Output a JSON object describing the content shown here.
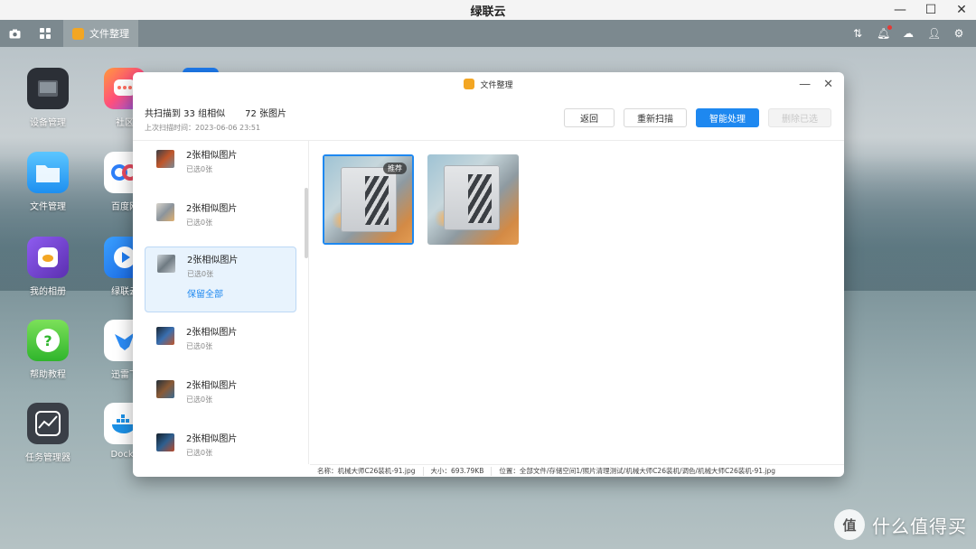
{
  "app_title": "绿联云",
  "window_controls": {
    "minimize": "—",
    "maximize": "☐",
    "close": "✕"
  },
  "taskbar": {
    "left_icons": [
      "camera-icon",
      "grid-apps-icon"
    ],
    "task_label": "文件整理",
    "right_icons": [
      "adjust-icon",
      "notification-bell-icon",
      "cloud-sync-icon",
      "user-icon",
      "settings-icon"
    ],
    "notification_dot_color": "#e53935"
  },
  "desktop": {
    "icons": [
      {
        "label": "设备管理",
        "icon": "device-manager-icon",
        "color": "#2b2f36"
      },
      {
        "label": "社区",
        "icon": "community-icon",
        "color": "#ff6f61"
      },
      {
        "label": "文件管理",
        "icon": "folder-icon",
        "color": "#1ea3f0"
      },
      {
        "label": "百度网",
        "icon": "baidu-netdisk-icon",
        "color": "#ffffff"
      },
      {
        "label": "我的相册",
        "icon": "photo-album-icon",
        "color": "#6a3fb5"
      },
      {
        "label": "绿联云",
        "icon": "video-play-icon",
        "color": "#1e7cf0"
      },
      {
        "label": "帮助教程",
        "icon": "help-icon",
        "color": "#48c13c"
      },
      {
        "label": "迅雷下",
        "icon": "xunlei-icon",
        "color": "#ffffff"
      },
      {
        "label": "任务管理器",
        "icon": "task-manager-icon",
        "color": "#3a3f47"
      },
      {
        "label": "Docke",
        "icon": "docker-icon",
        "color": "#ffffff"
      }
    ]
  },
  "window": {
    "title": "文件整理",
    "minimize": "—",
    "close": "✕",
    "summary": {
      "groups": "共扫描到 33 组相似",
      "images": "72 张图片"
    },
    "last_scan": "上次扫描时间：2023-06-06 23:51",
    "buttons": {
      "back": "返回",
      "rescan": "重新扫描",
      "smart": "智能处理",
      "delete_selected": "删除已选"
    }
  },
  "groups": [
    {
      "title": "2张相似图片",
      "selected": "已选0张",
      "active": false
    },
    {
      "title": "2张相似图片",
      "selected": "已选0张",
      "active": false
    },
    {
      "title": "2张相似图片",
      "selected": "已选0张",
      "active": true,
      "keep_all": "保留全部"
    },
    {
      "title": "2张相似图片",
      "selected": "已选0张",
      "active": false
    },
    {
      "title": "2张相似图片",
      "selected": "已选0张",
      "active": false
    },
    {
      "title": "2张相似图片",
      "selected": "已选0张",
      "active": false
    }
  ],
  "preview": {
    "recommend_tag": "推荐"
  },
  "statusbar": {
    "name": "名称：机械大师C26装机-91.jpg",
    "size": "大小：693.79KB",
    "location": "位置：全部文件/存储空间1/照片清理测试/机械大师C26装机/调色/机械大师C26装机-91.jpg"
  },
  "watermark": {
    "symbol": "值",
    "text": "什么值得买"
  },
  "colors": {
    "accent": "#1e88f0",
    "selected_bg": "#e8f3fd"
  }
}
